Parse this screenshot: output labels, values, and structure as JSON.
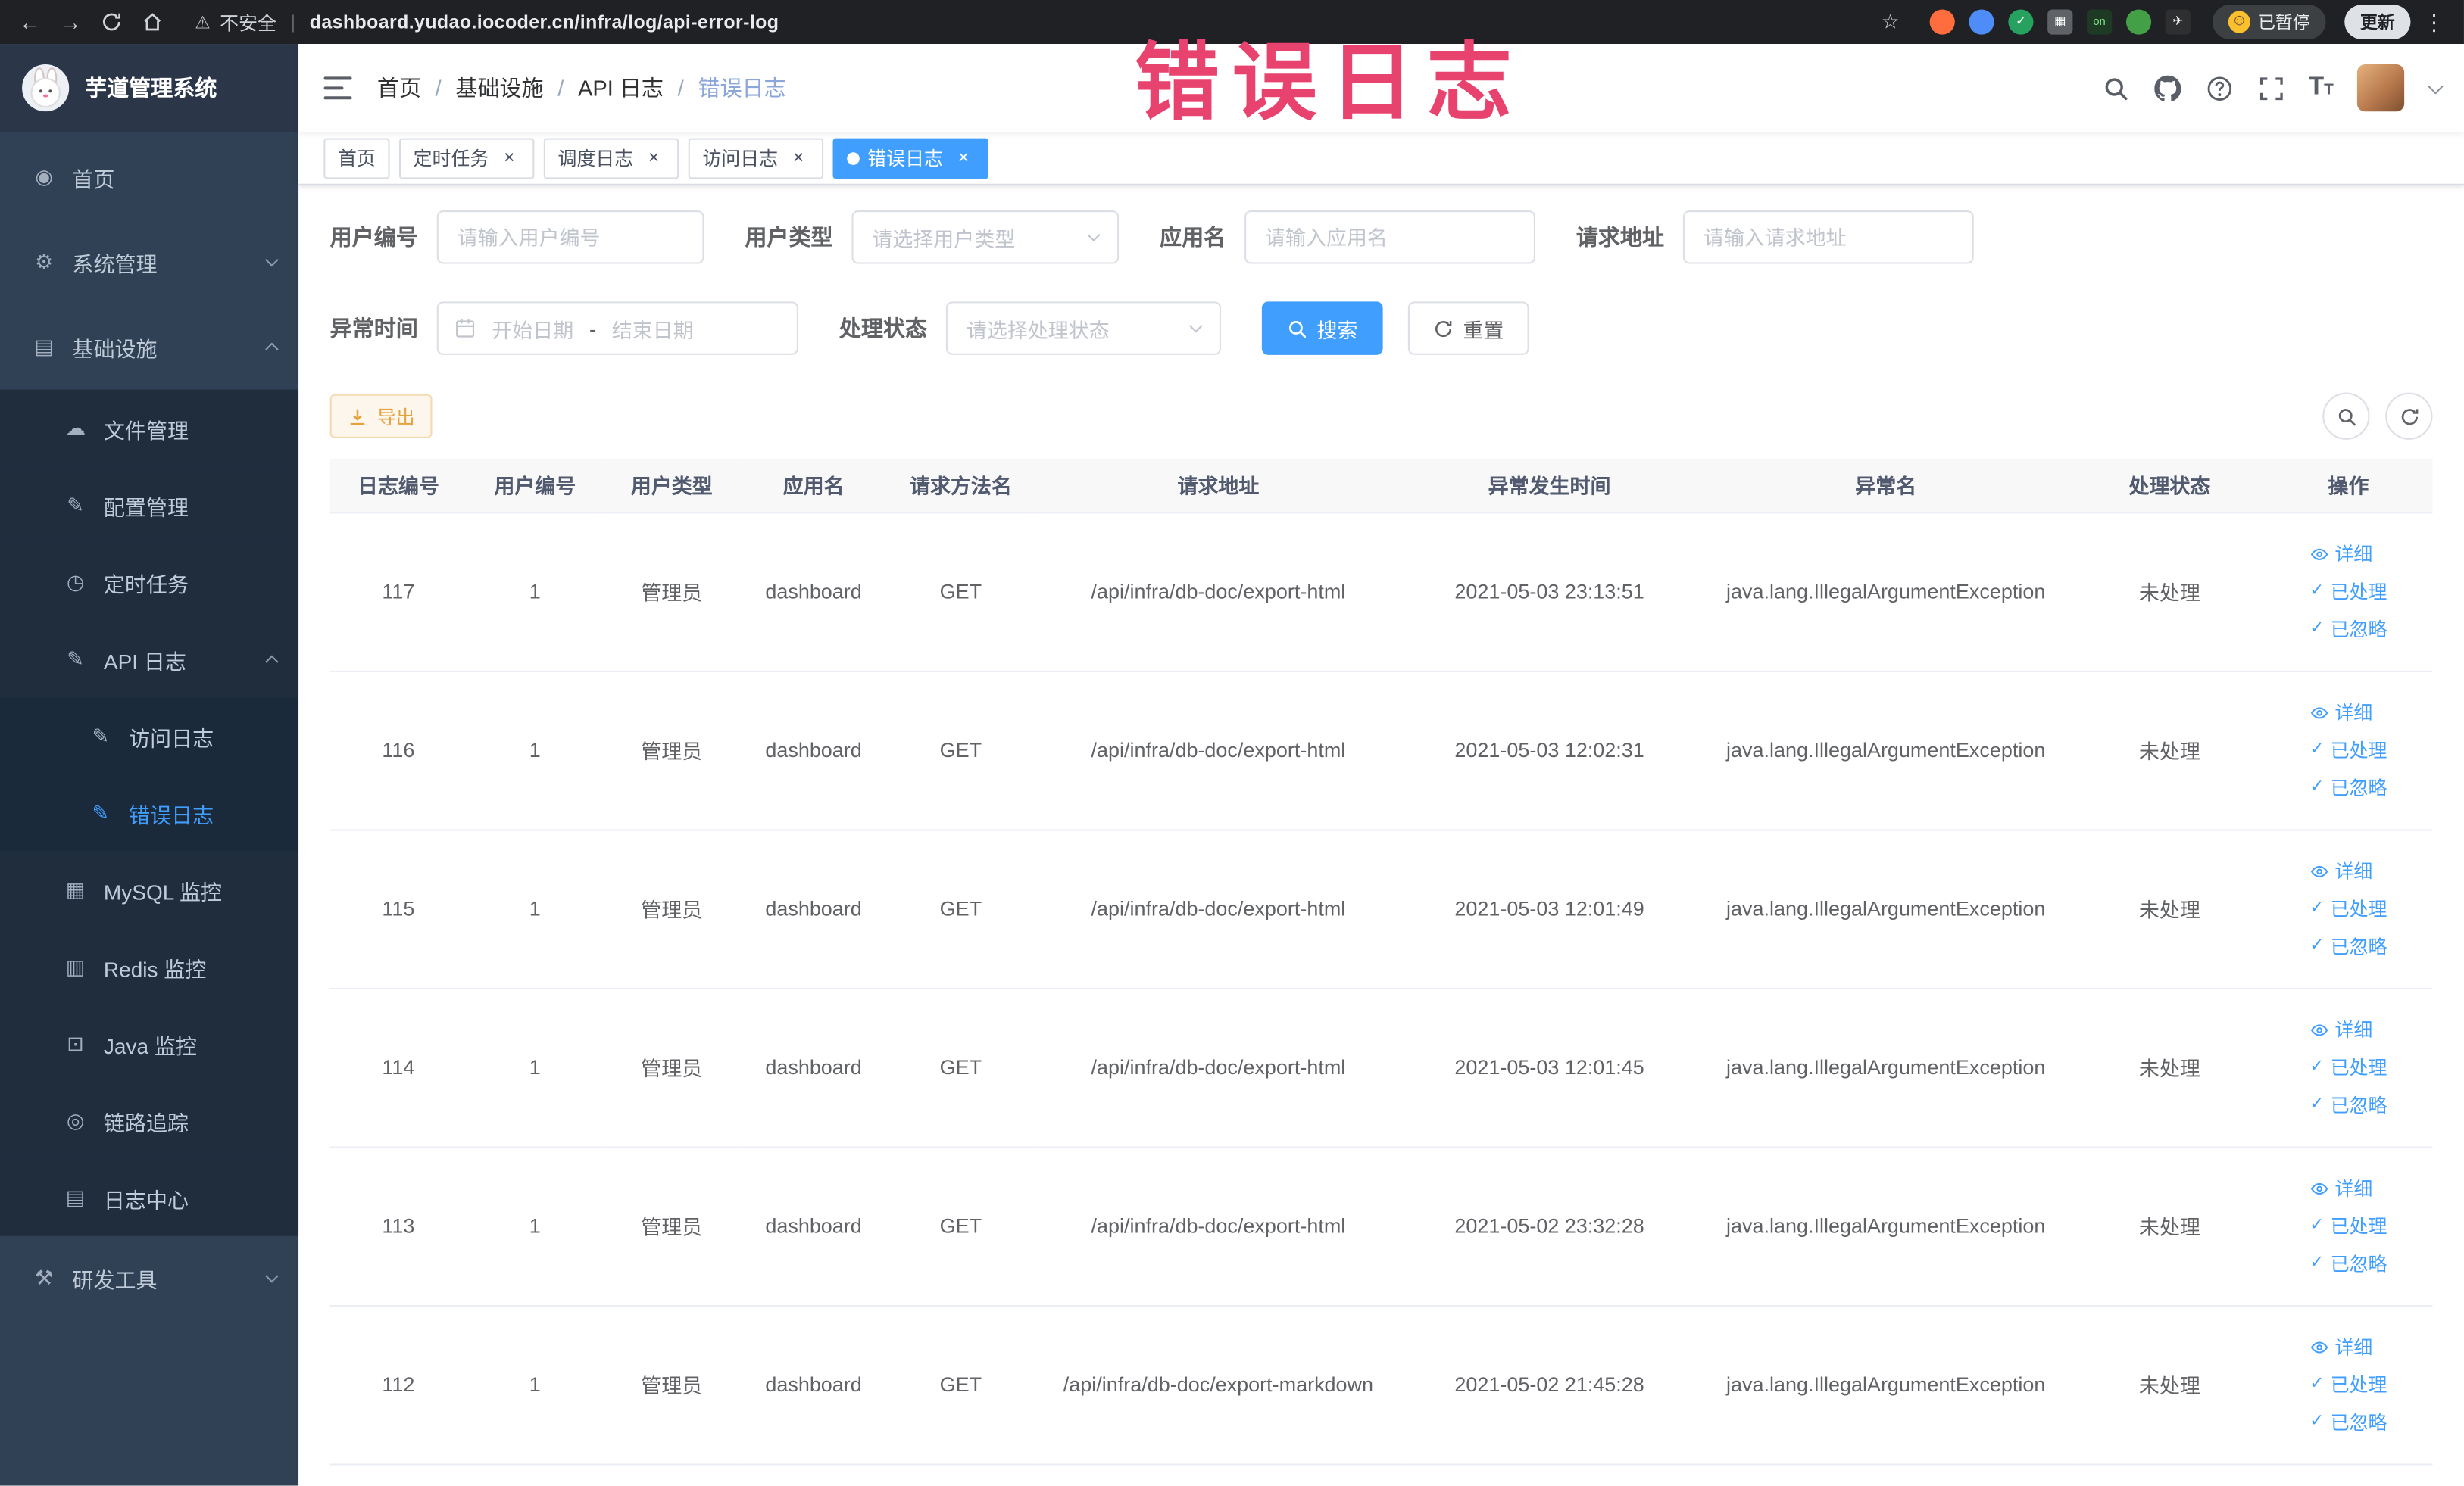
{
  "annotation": {
    "text": "错误日志"
  },
  "browser": {
    "back_glyph": "←",
    "forward_glyph": "→",
    "warning_glyph": "⚠",
    "security_label": "不安全",
    "separator": "|",
    "url": "dashboard.yudao.iocoder.cn/infra/log/api-error-log",
    "star_glyph": "☆",
    "menu_glyph": "⋮",
    "smiley_glyph": "☺",
    "paused_label": "已暂停",
    "update_label": "更新",
    "extensions": [
      {
        "name": "extension-orange",
        "bg": "#ff6d3f",
        "glyph": "",
        "shape": "circle"
      },
      {
        "name": "extension-blue-drop",
        "bg": "#4e8cf7",
        "glyph": "",
        "shape": "circle"
      },
      {
        "name": "extension-green-check",
        "bg": "#27a15f",
        "glyph": "✓",
        "shape": "circle"
      },
      {
        "name": "extension-apps-grid",
        "bg": "#5f6368",
        "glyph": "▦",
        "shape": "square"
      },
      {
        "name": "extension-on-badge",
        "bg": "#1e3a24",
        "glyph": "on",
        "fg": "#7ee787",
        "shape": "square"
      },
      {
        "name": "extension-leaf",
        "bg": "#43a047",
        "glyph": "",
        "shape": "circle"
      },
      {
        "name": "extension-plane",
        "bg": "#2d2f31",
        "glyph": "✈",
        "shape": "square"
      }
    ]
  },
  "sidebar": {
    "logo_title": "芋道管理系统",
    "items": [
      {
        "key": "home",
        "label": "首页",
        "icon": "dashboard",
        "glyph": "◉",
        "level": 1,
        "type": "item"
      },
      {
        "key": "system",
        "label": "系统管理",
        "icon": "gear",
        "glyph": "⚙",
        "level": 1,
        "type": "group",
        "expanded": false
      },
      {
        "key": "infra",
        "label": "基础设施",
        "icon": "monitor",
        "glyph": "▤",
        "level": 1,
        "type": "group",
        "expanded": true
      },
      {
        "key": "file-manage",
        "label": "文件管理",
        "icon": "cloud",
        "glyph": "☁",
        "level": 2,
        "type": "item"
      },
      {
        "key": "config-manage",
        "label": "配置管理",
        "icon": "edit",
        "glyph": "✎",
        "level": 2,
        "type": "item"
      },
      {
        "key": "scheduled-job",
        "label": "定时任务",
        "icon": "timer",
        "glyph": "◷",
        "level": 2,
        "type": "item"
      },
      {
        "key": "api-log",
        "label": "API 日志",
        "icon": "document",
        "glyph": "✎",
        "level": 2,
        "type": "group",
        "expanded": true
      },
      {
        "key": "access-log",
        "label": "访问日志",
        "icon": "document",
        "glyph": "✎",
        "level": 3,
        "type": "item"
      },
      {
        "key": "error-log",
        "label": "错误日志",
        "icon": "document",
        "glyph": "✎",
        "level": 3,
        "type": "item",
        "active": true
      },
      {
        "key": "mysql-monitor",
        "label": "MySQL 监控",
        "icon": "database",
        "glyph": "▦",
        "level": 2,
        "type": "item"
      },
      {
        "key": "redis-monitor",
        "label": "Redis 监控",
        "icon": "stack",
        "glyph": "▥",
        "level": 2,
        "type": "item"
      },
      {
        "key": "java-monitor",
        "label": "Java 监控",
        "icon": "screen",
        "glyph": "⊡",
        "level": 2,
        "type": "item"
      },
      {
        "key": "trace",
        "label": "链路追踪",
        "icon": "eye",
        "glyph": "◎",
        "level": 2,
        "type": "item"
      },
      {
        "key": "log-center",
        "label": "日志中心",
        "icon": "log",
        "glyph": "▤",
        "level": 2,
        "type": "item"
      },
      {
        "key": "dev-tools",
        "label": "研发工具",
        "icon": "hammer",
        "glyph": "⚒",
        "level": 1,
        "type": "group",
        "expanded": false
      }
    ]
  },
  "header": {
    "breadcrumb": [
      "首页",
      "基础设施",
      "API 日志",
      "错误日志"
    ],
    "font_size_glyph": "T"
  },
  "tabs": [
    {
      "label": "首页",
      "closable": false,
      "active": false
    },
    {
      "label": "定时任务",
      "closable": true,
      "active": false
    },
    {
      "label": "调度日志",
      "closable": true,
      "active": false
    },
    {
      "label": "访问日志",
      "closable": true,
      "active": false
    },
    {
      "label": "错误日志",
      "closable": true,
      "active": true
    }
  ],
  "filters": {
    "user_id": {
      "label": "用户编号",
      "placeholder": "请输入用户编号"
    },
    "user_type": {
      "label": "用户类型",
      "placeholder": "请选择用户类型"
    },
    "app_name": {
      "label": "应用名",
      "placeholder": "请输入应用名"
    },
    "request_url": {
      "label": "请求地址",
      "placeholder": "请输入请求地址"
    },
    "exception_time": {
      "label": "异常时间",
      "start_placeholder": "开始日期",
      "separator": "-",
      "end_placeholder": "结束日期"
    },
    "process_status": {
      "label": "处理状态",
      "placeholder": "请选择处理状态"
    },
    "search_label": "搜索",
    "reset_label": "重置"
  },
  "toolbar": {
    "export_label": "导出"
  },
  "table": {
    "columns": [
      "日志编号",
      "用户编号",
      "用户类型",
      "应用名",
      "请求方法名",
      "请求地址",
      "异常发生时间",
      "异常名",
      "处理状态",
      "操作"
    ],
    "actions": {
      "detail": "详细",
      "processed": "已处理",
      "ignored": "已忽略"
    },
    "rows": [
      {
        "id": "117",
        "user_id": "1",
        "user_type": "管理员",
        "app": "dashboard",
        "method": "GET",
        "url": "/api/infra/db-doc/export-html",
        "time": "2021-05-03 23:13:51",
        "exception": "java.lang.IllegalArgumentException",
        "status": "未处理"
      },
      {
        "id": "116",
        "user_id": "1",
        "user_type": "管理员",
        "app": "dashboard",
        "method": "GET",
        "url": "/api/infra/db-doc/export-html",
        "time": "2021-05-03 12:02:31",
        "exception": "java.lang.IllegalArgumentException",
        "status": "未处理"
      },
      {
        "id": "115",
        "user_id": "1",
        "user_type": "管理员",
        "app": "dashboard",
        "method": "GET",
        "url": "/api/infra/db-doc/export-html",
        "time": "2021-05-03 12:01:49",
        "exception": "java.lang.IllegalArgumentException",
        "status": "未处理"
      },
      {
        "id": "114",
        "user_id": "1",
        "user_type": "管理员",
        "app": "dashboard",
        "method": "GET",
        "url": "/api/infra/db-doc/export-html",
        "time": "2021-05-03 12:01:45",
        "exception": "java.lang.IllegalArgumentException",
        "status": "未处理"
      },
      {
        "id": "113",
        "user_id": "1",
        "user_type": "管理员",
        "app": "dashboard",
        "method": "GET",
        "url": "/api/infra/db-doc/export-html",
        "time": "2021-05-02 23:32:28",
        "exception": "java.lang.IllegalArgumentException",
        "status": "未处理"
      },
      {
        "id": "112",
        "user_id": "1",
        "user_type": "管理员",
        "app": "dashboard",
        "method": "GET",
        "url": "/api/infra/db-doc/export-markdown",
        "time": "2021-05-02 21:45:28",
        "exception": "java.lang.IllegalArgumentException",
        "status": "未处理"
      }
    ]
  },
  "colors": {
    "primary": "#409eff",
    "warning": "#e6a23c",
    "annotation": "#e8426e"
  }
}
